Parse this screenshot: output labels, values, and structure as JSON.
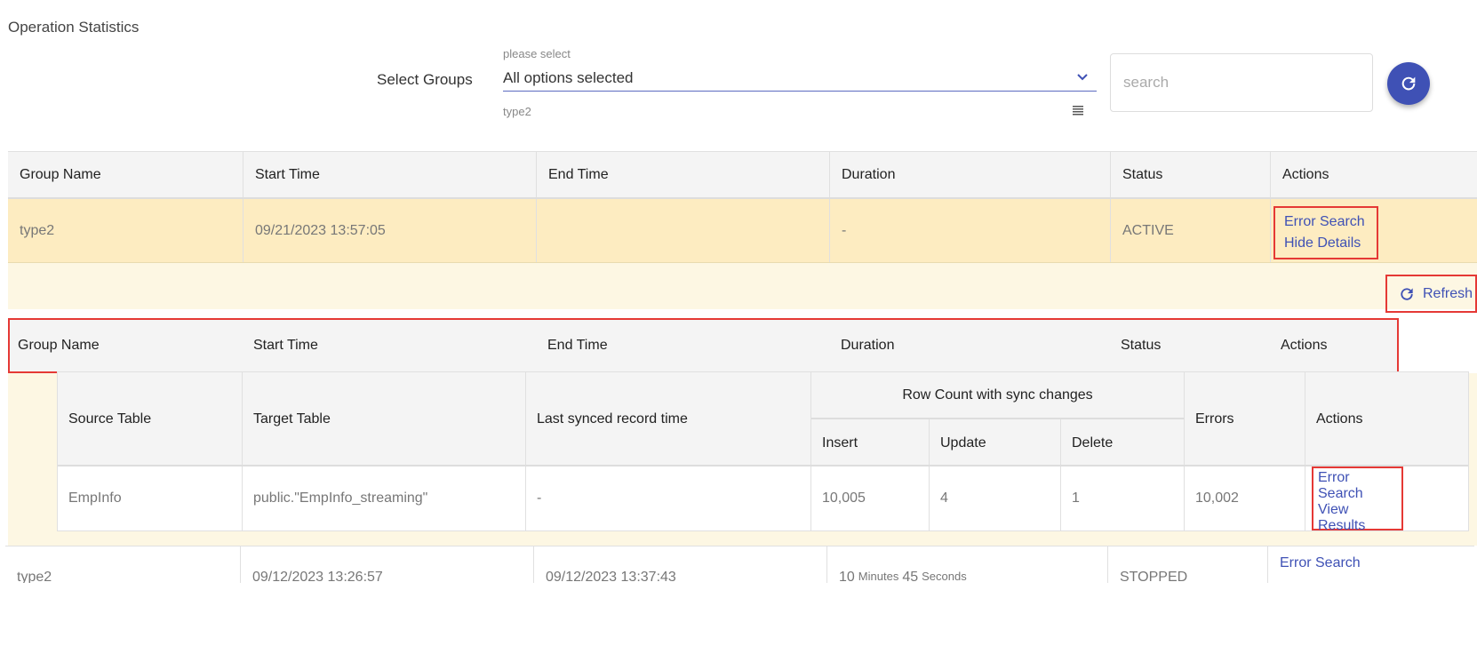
{
  "page": {
    "title": "Operation Statistics"
  },
  "filter": {
    "label": "Select Groups",
    "hint": "please select",
    "value": "All options selected",
    "chip": "type2",
    "search_placeholder": "search"
  },
  "table": {
    "columns": [
      "Group Name",
      "Start Time",
      "End Time",
      "Duration",
      "Status",
      "Actions"
    ],
    "rows": [
      {
        "group": "type2",
        "start": "09/21/2023 13:57:05",
        "end": "",
        "duration": "-",
        "status": "ACTIVE",
        "actions": [
          "Error Search",
          "Hide Details"
        ]
      },
      {
        "group": "type2",
        "start": "09/12/2023 13:26:57",
        "end": "09/12/2023 13:37:43",
        "duration_min": "10",
        "duration_min_unit": "Minutes",
        "duration_sec": "45",
        "duration_sec_unit": "Seconds",
        "status": "STOPPED",
        "actions": [
          "Error Search"
        ]
      }
    ]
  },
  "details": {
    "refresh_label": "Refresh",
    "columns": [
      "Group Name",
      "Start Time",
      "End Time",
      "Duration",
      "Status",
      "Actions"
    ],
    "inner": {
      "headers": {
        "source": "Source Table",
        "target": "Target Table",
        "last_synced": "Last synced record time",
        "row_count": "Row Count with sync changes",
        "insert": "Insert",
        "update": "Update",
        "delete": "Delete",
        "errors": "Errors",
        "actions": "Actions"
      },
      "row": {
        "source": "EmpInfo",
        "target": "public.\"EmpInfo_streaming\"",
        "last_synced": "-",
        "insert": "10,005",
        "update": "4",
        "delete": "1",
        "errors": "10,002",
        "actions": [
          "Error Search",
          "View Results"
        ]
      }
    }
  },
  "colors": {
    "accent": "#3f51b5",
    "highlight_row": "#fdecc1",
    "detail_band": "#fdf7e3",
    "annotation": "#e53935"
  }
}
